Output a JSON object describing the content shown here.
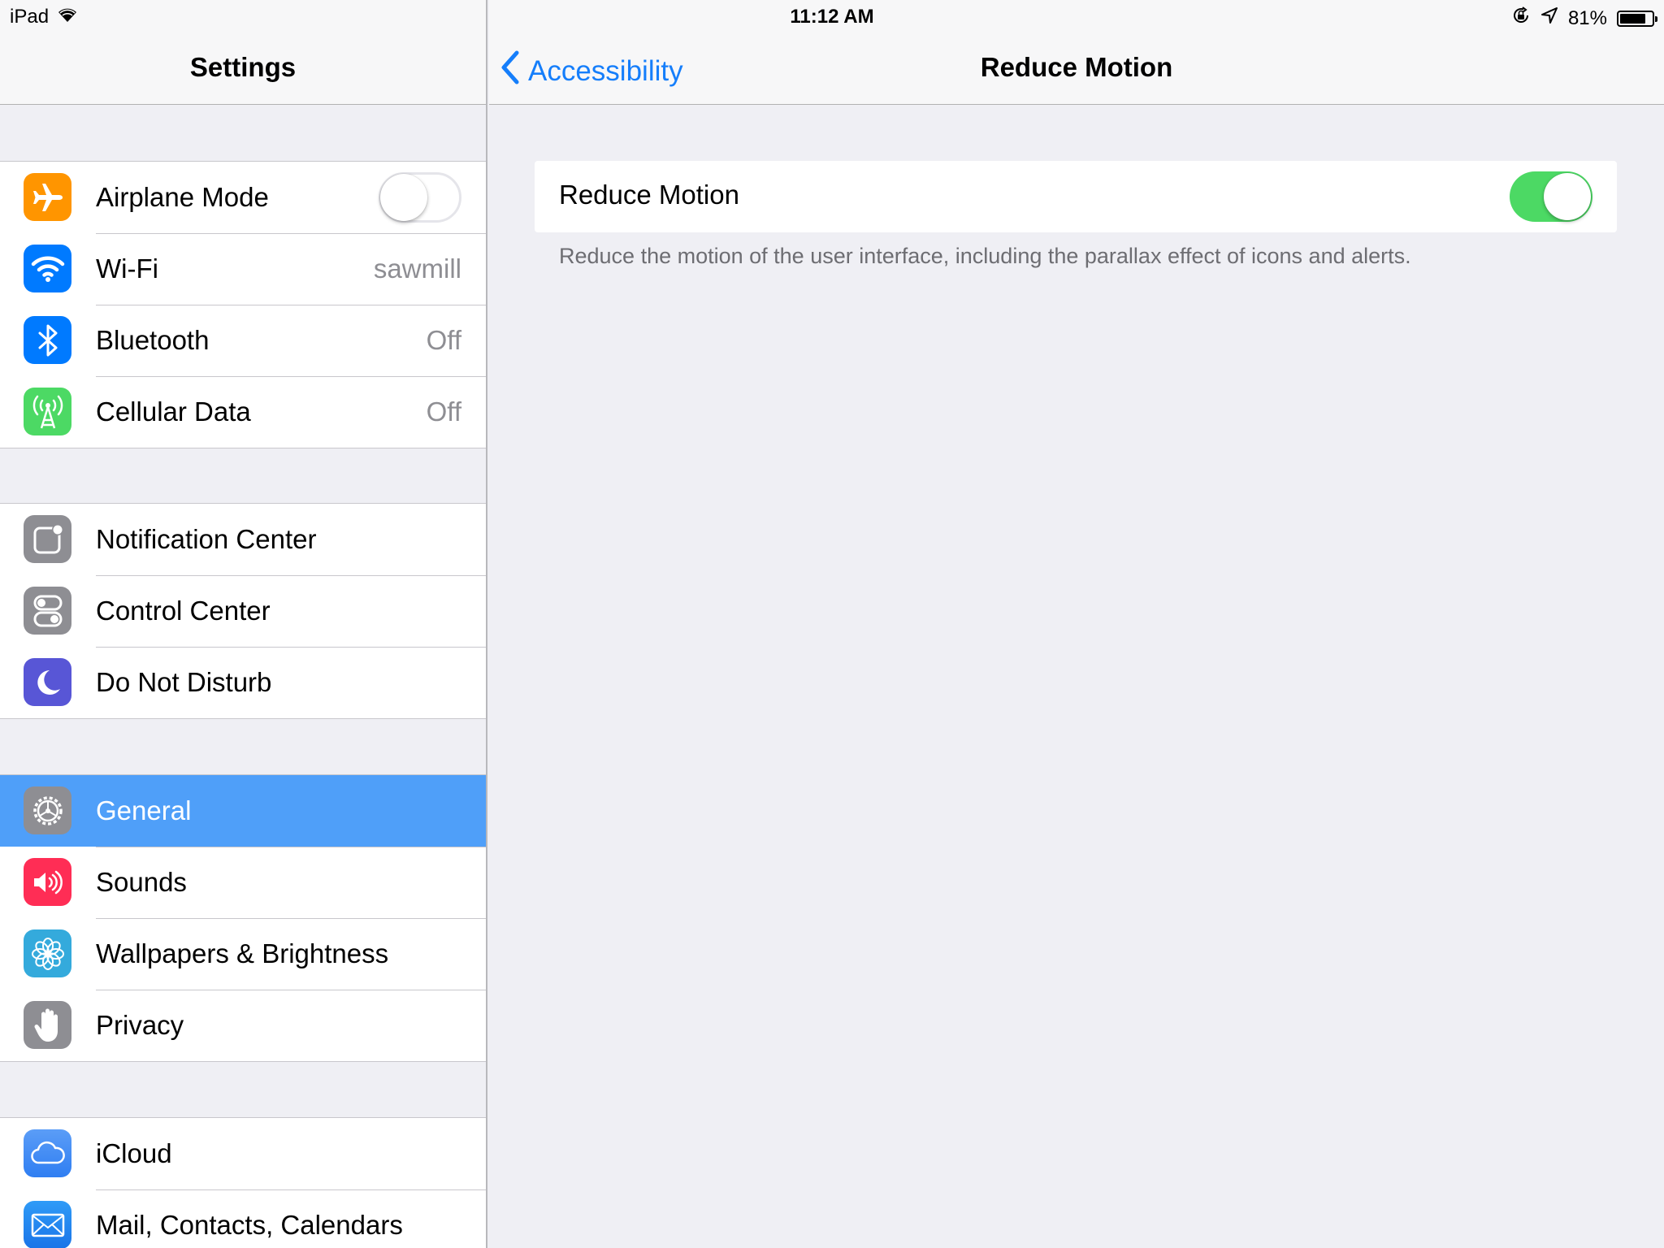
{
  "status_bar": {
    "device": "iPad",
    "time": "11:12 AM",
    "battery_percent": "81%",
    "battery_level": 0.81
  },
  "sidebar": {
    "title": "Settings",
    "groups": [
      {
        "items": [
          {
            "label": "Airplane Mode",
            "icon": "airplane-icon",
            "color": "#ff9500",
            "toggle_on": false
          },
          {
            "label": "Wi-Fi",
            "icon": "wifi-icon",
            "color": "#007aff",
            "value": "sawmill"
          },
          {
            "label": "Bluetooth",
            "icon": "bluetooth-icon",
            "color": "#007aff",
            "value": "Off"
          },
          {
            "label": "Cellular Data",
            "icon": "cellular-icon",
            "color": "#4cd964",
            "value": "Off"
          }
        ]
      },
      {
        "items": [
          {
            "label": "Notification Center",
            "icon": "notification-center-icon",
            "color": "#8e8e93"
          },
          {
            "label": "Control Center",
            "icon": "control-center-icon",
            "color": "#8e8e93"
          },
          {
            "label": "Do Not Disturb",
            "icon": "moon-icon",
            "color": "#5856d6"
          }
        ]
      },
      {
        "items": [
          {
            "label": "General",
            "icon": "gear-icon",
            "color": "#8e8e93",
            "selected": true
          },
          {
            "label": "Sounds",
            "icon": "speaker-icon",
            "color": "#ff2d55"
          },
          {
            "label": "Wallpapers & Brightness",
            "icon": "flower-icon",
            "color": "#34aadc"
          },
          {
            "label": "Privacy",
            "icon": "hand-icon",
            "color": "#8e8e93"
          }
        ]
      },
      {
        "items": [
          {
            "label": "iCloud",
            "icon": "cloud-icon",
            "color": "#3d8bf5"
          },
          {
            "label": "Mail, Contacts, Calendars",
            "icon": "mail-icon",
            "color": "#1a8cf0"
          }
        ]
      }
    ]
  },
  "detail": {
    "back_label": "Accessibility",
    "title": "Reduce Motion",
    "setting_label": "Reduce Motion",
    "setting_on": true,
    "footer": "Reduce the motion of the user interface, including the parallax effect of icons and alerts."
  },
  "colors": {
    "accent": "#157efb",
    "selection": "#4f9ff9",
    "switch_on": "#4cd964",
    "background": "#efeff4"
  }
}
